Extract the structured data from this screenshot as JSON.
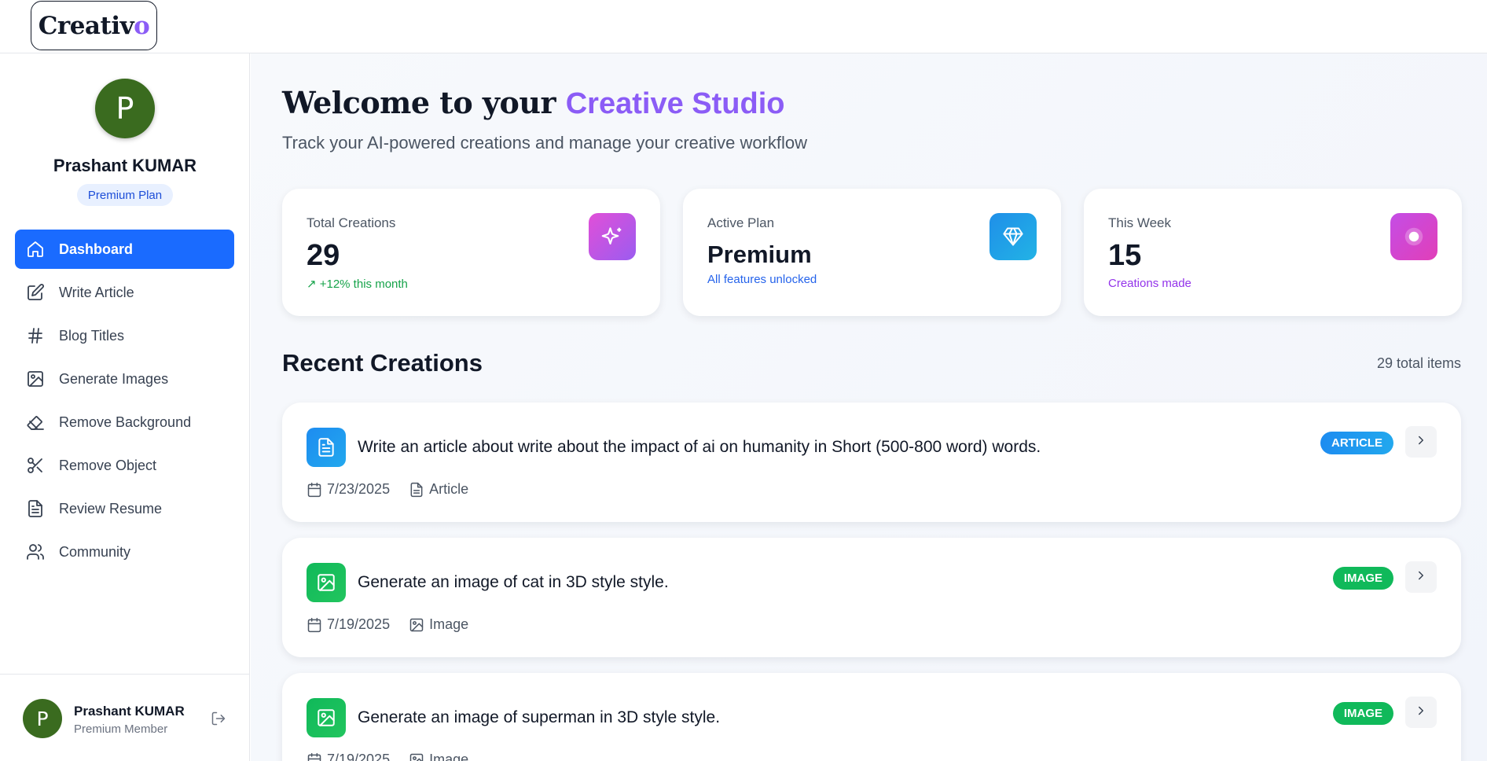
{
  "brand": {
    "logo_main": "Creativ",
    "logo_accent": "o"
  },
  "sidebar": {
    "avatar_initial": "P",
    "user_name": "Prashant KUMAR",
    "plan_label": "Premium Plan",
    "items": [
      {
        "label": "Dashboard",
        "icon": "home-icon",
        "active": true
      },
      {
        "label": "Write Article",
        "icon": "edit-icon"
      },
      {
        "label": "Blog Titles",
        "icon": "hash-icon"
      },
      {
        "label": "Generate Images",
        "icon": "image-icon"
      },
      {
        "label": "Remove Background",
        "icon": "eraser-icon"
      },
      {
        "label": "Remove Object",
        "icon": "scissors-icon"
      },
      {
        "label": "Review Resume",
        "icon": "file-text-icon"
      },
      {
        "label": "Community",
        "icon": "users-icon"
      }
    ],
    "footer": {
      "avatar_initial": "P",
      "name": "Prashant KUMAR",
      "role": "Premium Member"
    }
  },
  "header": {
    "welcome_prefix": "Welcome to your",
    "welcome_highlight": "Creative Studio",
    "subtitle": "Track your AI-powered creations and manage your creative workflow"
  },
  "stats": [
    {
      "label": "Total Creations",
      "value": "29",
      "sub": "↗ +12% this month",
      "sub_color": "#16a34a",
      "icon": "sparkles-icon"
    },
    {
      "label": "Active Plan",
      "value": "Premium",
      "sub": "All features unlocked",
      "sub_color": "#2563eb",
      "icon": "gem-icon"
    },
    {
      "label": "This Week",
      "value": "15",
      "sub": "Creations made",
      "sub_color": "#9333ea",
      "icon": "record-icon"
    }
  ],
  "recent": {
    "title": "Recent Creations",
    "count_label": "29 total items",
    "items": [
      {
        "prompt": "Write an article about write about the impact of ai on humanity in Short (500-800 word) words.",
        "date": "7/23/2025",
        "type": "Article",
        "tag": "ARTICLE",
        "tag_color": "#1d8cf0"
      },
      {
        "prompt": "Generate an image of cat in 3D style style.",
        "date": "7/19/2025",
        "type": "Image",
        "tag": "IMAGE",
        "tag_color": "#10b95a"
      },
      {
        "prompt": "Generate an image of superman in 3D style style.",
        "date": "7/19/2025",
        "type": "Image",
        "tag": "IMAGE",
        "tag_color": "#10b95a"
      }
    ]
  },
  "colors": {
    "accent": "#8b5cf6",
    "nav_active": "#1a6bff",
    "avatar_bg": "#3a6b1f"
  }
}
